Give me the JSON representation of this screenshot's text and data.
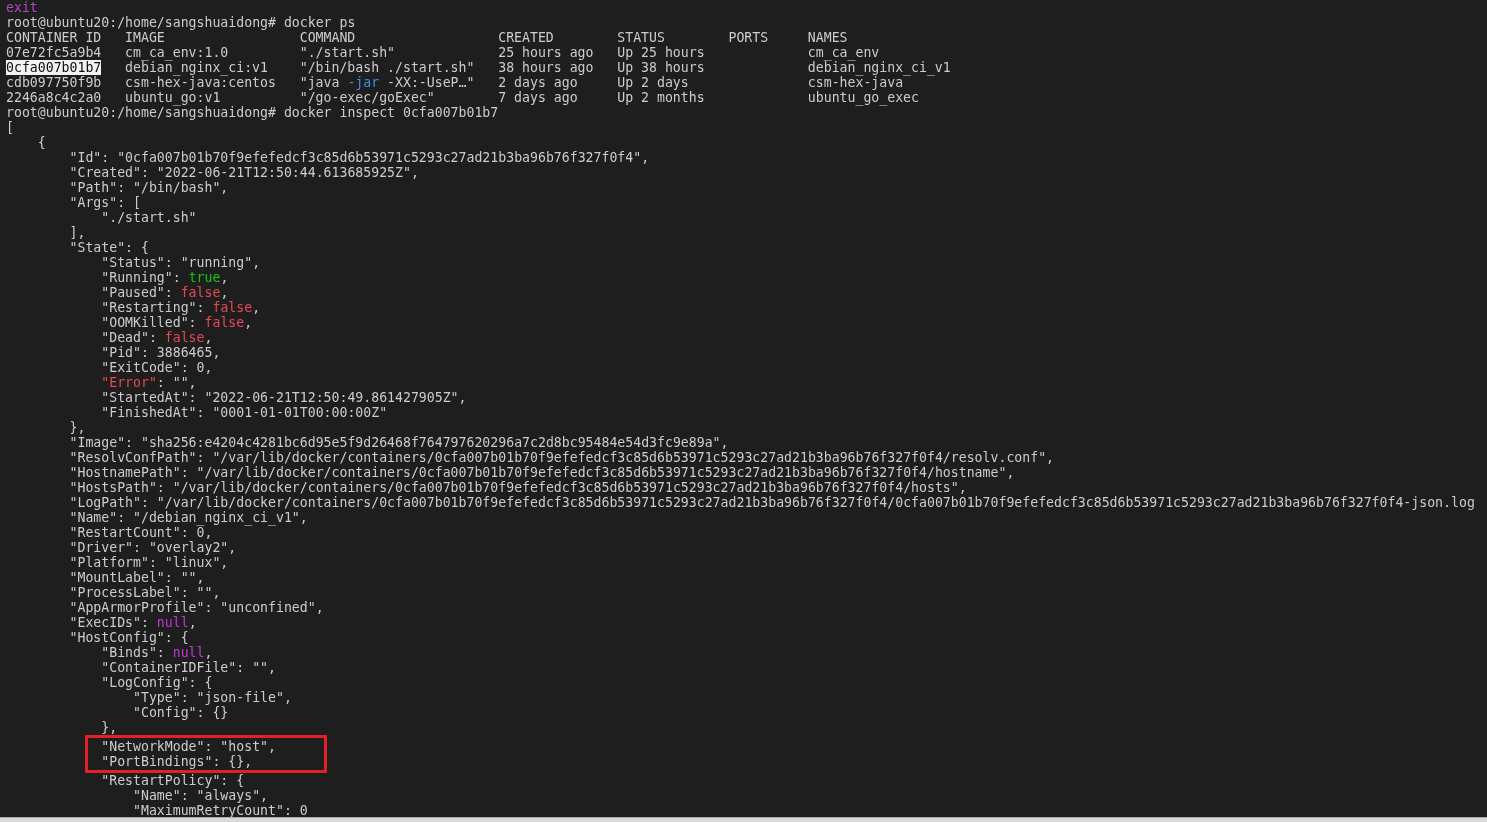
{
  "terminal": {
    "pre_lines": [
      {
        "parts": [
          {
            "text": "exit",
            "kind": "exit"
          }
        ]
      },
      {
        "text": "root@ubuntu20:/home/sangshuaidong# docker ps"
      }
    ],
    "ps_table": {
      "columns": [
        "CONTAINER ID",
        "IMAGE",
        "COMMAND",
        "CREATED",
        "STATUS",
        "PORTS",
        "NAMES"
      ],
      "rows": [
        {
          "selected": false,
          "cells": [
            "07e72fc5a9b4",
            "cm_ca_env:1.0",
            [
              {
                "text": "\"./start.sh\""
              }
            ],
            "25 hours ago",
            "Up 25 hours",
            "",
            "cm_ca_env"
          ]
        },
        {
          "selected": true,
          "cells": [
            "0cfa007b01b7",
            "debian_nginx_ci:v1",
            [
              {
                "text": "\"/bin/bash ./start.sh\""
              }
            ],
            "38 hours ago",
            "Up 38 hours",
            "",
            "debian_nginx_ci_v1"
          ]
        },
        {
          "selected": false,
          "cells": [
            "cdb097750f9b",
            "csm-hex-java:centos",
            [
              {
                "text": "\"java "
              },
              {
                "text": "-jar",
                "kind": "flag"
              },
              {
                "text": " -XX:-UseP…\""
              }
            ],
            "2 days ago",
            "Up 2 days",
            "",
            "csm-hex-java"
          ]
        },
        {
          "selected": false,
          "cells": [
            "2246a8c4c2a0",
            "ubuntu_go:v1",
            [
              {
                "text": "\"/go-exec/goExec\""
              }
            ],
            "7 days ago",
            "Up 2 months",
            "",
            "ubuntu_go_exec"
          ]
        }
      ]
    },
    "lines": [
      {
        "text": "root@ubuntu20:/home/sangshuaidong# docker inspect 0cfa007b01b7",
        "highlighted": false
      },
      {
        "text": "[",
        "highlighted": false
      },
      {
        "text": "    {",
        "highlighted": false
      },
      {
        "text": "        \"Id\": \"0cfa007b01b70f9efefedcf3c85d6b53971c5293c27ad21b3ba96b76f327f0f4\",",
        "highlighted": false
      },
      {
        "text": "        \"Created\": \"2022-06-21T12:50:44.613685925Z\",",
        "highlighted": false
      },
      {
        "text": "        \"Path\": \"/bin/bash\",",
        "highlighted": false
      },
      {
        "text": "        \"Args\": [",
        "highlighted": false
      },
      {
        "text": "            \"./start.sh\"",
        "highlighted": false
      },
      {
        "text": "        ],",
        "highlighted": false
      },
      {
        "text": "        \"State\": {",
        "highlighted": false
      },
      {
        "text": "            \"Status\": \"running\",",
        "highlighted": false
      },
      {
        "parts": [
          {
            "text": "            \"Running\": "
          },
          {
            "text": "true",
            "kind": "bool_true"
          },
          {
            "text": ","
          }
        ],
        "highlighted": false
      },
      {
        "parts": [
          {
            "text": "            \"Paused\": "
          },
          {
            "text": "false",
            "kind": "bool_false"
          },
          {
            "text": ","
          }
        ],
        "highlighted": false
      },
      {
        "parts": [
          {
            "text": "            \"Restarting\": "
          },
          {
            "text": "false",
            "kind": "bool_false"
          },
          {
            "text": ","
          }
        ],
        "highlighted": false
      },
      {
        "parts": [
          {
            "text": "            \"OOMKilled\": "
          },
          {
            "text": "false",
            "kind": "bool_false"
          },
          {
            "text": ","
          }
        ],
        "highlighted": false
      },
      {
        "parts": [
          {
            "text": "            \"Dead\": "
          },
          {
            "text": "false",
            "kind": "bool_false"
          },
          {
            "text": ","
          }
        ],
        "highlighted": false
      },
      {
        "text": "            \"Pid\": 3886465,",
        "highlighted": false
      },
      {
        "text": "            \"ExitCode\": 0,",
        "highlighted": false
      },
      {
        "parts": [
          {
            "text": "            \"Error\"",
            "kind": "error_key"
          },
          {
            "text": ": \"\","
          }
        ],
        "highlighted": false
      },
      {
        "text": "            \"StartedAt\": \"2022-06-21T12:50:49.861427905Z\",",
        "highlighted": false
      },
      {
        "text": "            \"FinishedAt\": \"0001-01-01T00:00:00Z\"",
        "highlighted": false
      },
      {
        "text": "        },",
        "highlighted": false
      },
      {
        "text": "        \"Image\": \"sha256:e4204c4281bc6d95e5f9d26468f764797620296a7c2d8bc95484e54d3fc9e89a\",",
        "highlighted": false
      },
      {
        "text": "        \"ResolvConfPath\": \"/var/lib/docker/containers/0cfa007b01b70f9efefedcf3c85d6b53971c5293c27ad21b3ba96b76f327f0f4/resolv.conf\",",
        "highlighted": false
      },
      {
        "text": "        \"HostnamePath\": \"/var/lib/docker/containers/0cfa007b01b70f9efefedcf3c85d6b53971c5293c27ad21b3ba96b76f327f0f4/hostname\",",
        "highlighted": false
      },
      {
        "text": "        \"HostsPath\": \"/var/lib/docker/containers/0cfa007b01b70f9efefedcf3c85d6b53971c5293c27ad21b3ba96b76f327f0f4/hosts\",",
        "highlighted": false
      },
      {
        "text": "        \"LogPath\": \"/var/lib/docker/containers/0cfa007b01b70f9efefedcf3c85d6b53971c5293c27ad21b3ba96b76f327f0f4/0cfa007b01b70f9efefedcf3c85d6b53971c5293c27ad21b3ba96b76f327f0f4-json.log",
        "highlighted": false
      },
      {
        "text": "        \"Name\": \"/debian_nginx_ci_v1\",",
        "highlighted": false
      },
      {
        "text": "        \"RestartCount\": 0,",
        "highlighted": false
      },
      {
        "text": "        \"Driver\": \"overlay2\",",
        "highlighted": false
      },
      {
        "text": "        \"Platform\": \"linux\",",
        "highlighted": false
      },
      {
        "text": "        \"MountLabel\": \"\",",
        "highlighted": false
      },
      {
        "text": "        \"ProcessLabel\": \"\",",
        "highlighted": false
      },
      {
        "text": "        \"AppArmorProfile\": \"unconfined\",",
        "highlighted": false
      },
      {
        "parts": [
          {
            "text": "        \"ExecIDs\": "
          },
          {
            "text": "null",
            "kind": "null"
          },
          {
            "text": ","
          }
        ],
        "highlighted": false
      },
      {
        "text": "        \"HostConfig\": {",
        "highlighted": false
      },
      {
        "parts": [
          {
            "text": "            \"Binds\": "
          },
          {
            "text": "null",
            "kind": "null"
          },
          {
            "text": ","
          }
        ],
        "highlighted": false
      },
      {
        "text": "            \"ContainerIDFile\": \"\",",
        "highlighted": false
      },
      {
        "text": "            \"LogConfig\": {",
        "highlighted": false
      },
      {
        "text": "                \"Type\": \"json-file\",",
        "highlighted": false
      },
      {
        "text": "                \"Config\": {}",
        "highlighted": false
      },
      {
        "text": "            },",
        "highlighted": false
      },
      {
        "text": "            \"NetworkMode\": \"host\",",
        "highlighted": true
      },
      {
        "text": "            \"PortBindings\": {},",
        "highlighted": true
      },
      {
        "text": "            \"RestartPolicy\": {",
        "highlighted": false
      },
      {
        "text": "                \"Name\": \"always\",",
        "highlighted": false
      },
      {
        "text": "                \"MaximumRetryCount\": 0",
        "highlighted": false
      }
    ]
  }
}
